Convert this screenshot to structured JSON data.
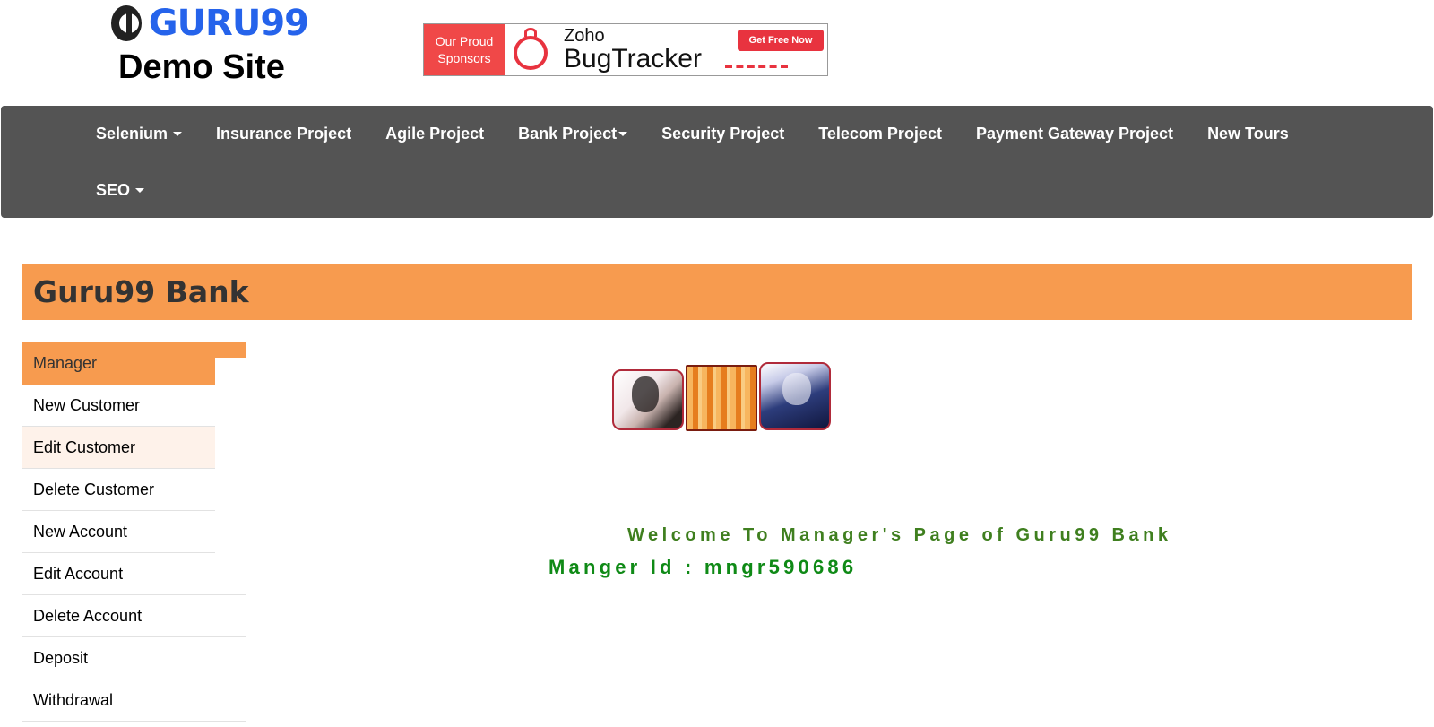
{
  "header": {
    "logo_text": "GURU99",
    "logo_subtitle": "Demo Site",
    "sponsor": {
      "left_line1": "Our Proud",
      "left_line2": "Sponsors",
      "brand": "Zoho",
      "product": "BugTracker",
      "cta": "Get Free Now"
    }
  },
  "navbar": {
    "items": [
      {
        "label": "Selenium",
        "dropdown": true
      },
      {
        "label": "Insurance Project",
        "dropdown": false
      },
      {
        "label": "Agile Project",
        "dropdown": false
      },
      {
        "label": "Bank Project",
        "dropdown": true
      },
      {
        "label": "Security Project",
        "dropdown": false
      },
      {
        "label": "Telecom Project",
        "dropdown": false
      },
      {
        "label": "Payment Gateway Project",
        "dropdown": false
      },
      {
        "label": "New Tours",
        "dropdown": false
      },
      {
        "label": "SEO",
        "dropdown": true
      }
    ]
  },
  "bank": {
    "title": "Guru99 Bank"
  },
  "menu": {
    "items": [
      {
        "label": "Manager",
        "state": "active"
      },
      {
        "label": "New Customer",
        "state": "normal"
      },
      {
        "label": "Edit Customer",
        "state": "hover"
      },
      {
        "label": "Delete Customer",
        "state": "normal"
      },
      {
        "label": "New Account",
        "state": "normal"
      },
      {
        "label": "Edit Account",
        "state": "normal"
      },
      {
        "label": "Delete Account",
        "state": "normal"
      },
      {
        "label": "Deposit",
        "state": "normal"
      },
      {
        "label": "Withdrawal",
        "state": "normal"
      }
    ]
  },
  "main": {
    "welcome": "Welcome To Manager's Page of Guru99 Bank",
    "manager_id": "Manger Id : mngr590686"
  },
  "colors": {
    "navbar_bg": "#545454",
    "accent_orange": "#f79b4f",
    "welcome_green": "#3f7f1f",
    "id_green": "#0f8a16",
    "logo_blue": "#2563eb"
  }
}
